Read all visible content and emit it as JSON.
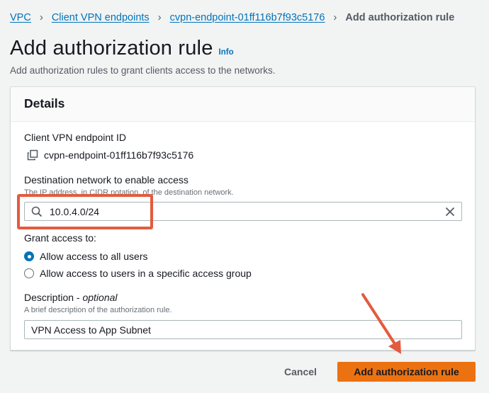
{
  "breadcrumb": {
    "items": [
      "VPC",
      "Client VPN endpoints",
      "cvpn-endpoint-01ff116b7f93c5176"
    ],
    "current": "Add authorization rule"
  },
  "header": {
    "title": "Add authorization rule",
    "info": "Info",
    "description": "Add authorization rules to grant clients access to the networks."
  },
  "details": {
    "title": "Details",
    "endpoint_label": "Client VPN endpoint ID",
    "endpoint_value": "cvpn-endpoint-01ff116b7f93c5176",
    "destination_label": "Destination network to enable access",
    "destination_hint": "The IP address, in CIDR notation, of the destination network.",
    "destination_value": "10.0.4.0/24",
    "grant_label": "Grant access to:",
    "grant_options": [
      "Allow access to all users",
      "Allow access to users in a specific access group"
    ],
    "grant_selected": "Allow access to all users",
    "description_label": "Description - ",
    "description_optional": "optional",
    "description_hint": "A brief description of the authorization rule.",
    "description_value": "VPN Access to App Subnet"
  },
  "actions": {
    "cancel": "Cancel",
    "submit": "Add authorization rule"
  },
  "colors": {
    "link": "#0073bb",
    "primary_button": "#ec7211",
    "annotation": "#e35b3f"
  },
  "icons": [
    "copy-icon",
    "search-icon",
    "clear-icon",
    "chevron-right-icon"
  ]
}
